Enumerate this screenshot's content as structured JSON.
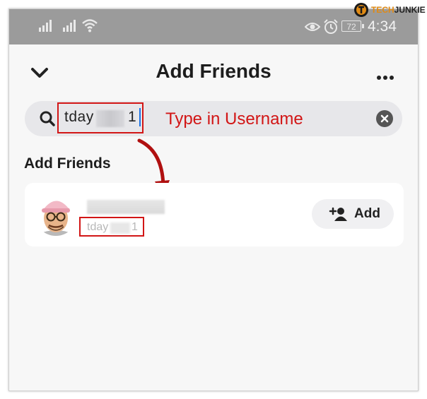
{
  "watermark": {
    "tech": "TECH",
    "junkie": "JUNKIE",
    "icon": "techjunkie-logo"
  },
  "status_bar": {
    "time": "4:34",
    "battery": "72",
    "icons": [
      "signal-icon",
      "signal-icon",
      "wifi-icon",
      "eye-icon",
      "alarm-icon",
      "battery-icon"
    ]
  },
  "header": {
    "title": "Add Friends",
    "back_icon": "chevron-down-icon",
    "more_icon": "more-icon"
  },
  "search": {
    "value_prefix": "tday",
    "value_suffix": "1",
    "clear_icon": "clear-icon",
    "icon": "search-icon"
  },
  "annotation": {
    "text": "Type in Username",
    "color": "#d21616"
  },
  "section": {
    "title": "Add Friends"
  },
  "results": [
    {
      "username_prefix": "tday",
      "username_suffix": "1",
      "action_label": "Add",
      "action_icon": "add-friend-icon"
    }
  ],
  "colors": {
    "annotation_red": "#d21616",
    "status_bar": "#9b9b9b",
    "caret": "#1a73e8"
  }
}
